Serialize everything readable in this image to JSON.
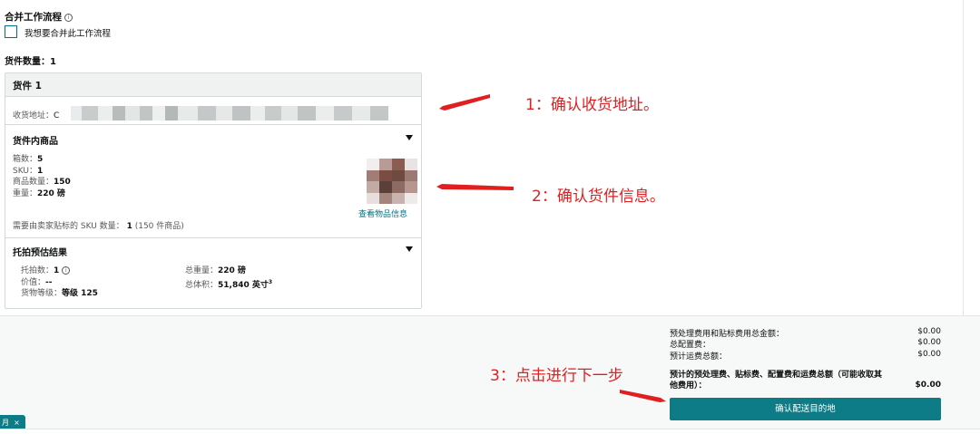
{
  "workflow": {
    "title": "合并工作流程",
    "checkbox_label": "我想要合并此工作流程",
    "checked": false
  },
  "shipment_count": "货件数量：1",
  "card": {
    "title": "货件 1",
    "address_label": "收货地址：",
    "address_prefix": "C",
    "contents": {
      "title": "货件内商品",
      "boxes_label": "箱数：",
      "boxes_value": "5",
      "sku_label": "SKU：",
      "sku_value": "1",
      "units_label": "商品数量：",
      "units_value": "150",
      "weight_label": "重量：",
      "weight_value": "220 磅",
      "view_items_link": "查看物品信息",
      "labeling_label": "需要由卖家贴标的 SKU 数量：",
      "labeling_value": "1",
      "labeling_suffix": "(150 件商品)"
    },
    "pallet": {
      "title": "托拍预估结果",
      "pallets_label": "托拍数：",
      "pallets_value": "1",
      "value_label": "价值：",
      "value_value": "--",
      "class_label": "货物等级：",
      "class_value": "等级 125",
      "total_weight_label": "总重量：",
      "total_weight_value": "220 磅",
      "total_volume_label": "总体积：",
      "total_volume_value": "51,840 英寸",
      "volume_unit_sup": "3"
    }
  },
  "summary": {
    "rows": [
      {
        "label": "预处理费用和贴标费用总金额：",
        "value": "$0.00"
      },
      {
        "label": "总配置费：",
        "value": "$0.00"
      },
      {
        "label": "预计运费总额：",
        "value": "$0.00"
      }
    ],
    "total_label_line1": "预计的预处理费、贴标费、配置费和运费总额（可能收取其",
    "total_label_line2": "他费用）：",
    "total_value": "$0.00",
    "confirm_button": "确认配送目的地"
  },
  "pill": {
    "text": "月",
    "close": "×"
  },
  "annotations": {
    "step1": "1：确认收货地址。",
    "step2": "2：确认货件信息。",
    "step3": "3：点击进行下一步",
    "color": "#e02020"
  },
  "colors": {
    "primary_button": "#0e7c86",
    "link": "#007185"
  }
}
